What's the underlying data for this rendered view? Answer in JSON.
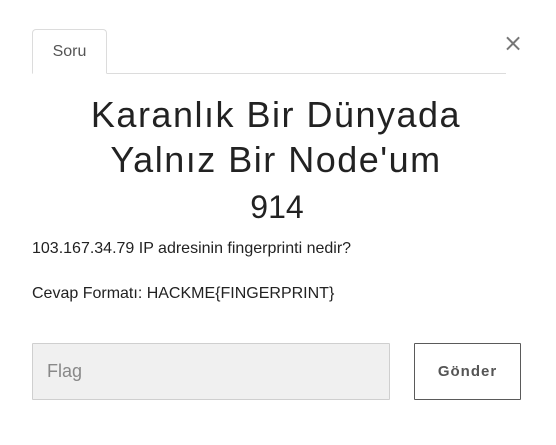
{
  "modal": {
    "tab_label": "Soru",
    "close_glyph": "×",
    "title_line1": "Karanlık Bir Dünyada",
    "title_line2": "Yalnız Bir Node'um",
    "points": "914",
    "question": "103.167.34.79 IP adresinin fingerprinti nedir?",
    "answer_format": "Cevap Formatı: HACKME{FINGERPRINT}",
    "flag_placeholder": "Flag",
    "flag_value": "",
    "submit_label": "Gönder"
  }
}
